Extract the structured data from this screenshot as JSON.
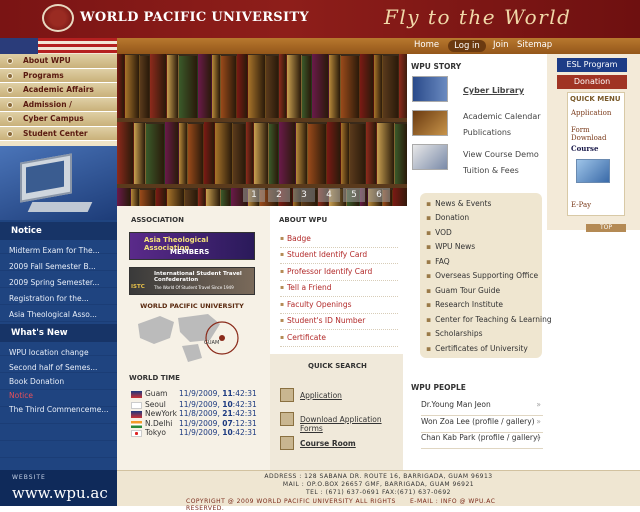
{
  "header": {
    "title": "WORLD PACIFIC UNIVERSITY",
    "slogan": "Fly to the World"
  },
  "topnav": {
    "home": "Home",
    "login": "Log in",
    "join": "Join",
    "sitemap": "Sitemap"
  },
  "leftnav": [
    "About WPU",
    "Programs",
    "Academic Affairs",
    "Admission / Graduation",
    "Cyber Campus",
    "Student Center"
  ],
  "notice": {
    "title": "Notice",
    "items": [
      "Midterm Exam for The...",
      "2009 Fall Semester B...",
      "2009 Spring Semester...",
      "Registration for the...",
      "Asia Theological Asso..."
    ]
  },
  "whatsnew": {
    "title": "What's New",
    "items": [
      "WPU location change",
      "Second half of Semes...",
      "Book Donation",
      "Notice",
      "The Third Commenceme..."
    ]
  },
  "website": {
    "label": "WEBSITE",
    "url": "www.wpu.ac"
  },
  "hero": {
    "pages": [
      "1",
      "2",
      "3",
      "4",
      "5",
      "6"
    ]
  },
  "story": {
    "title": "WPU STORY",
    "items": [
      "Cyber Library",
      "Academic Calendar",
      "Publications",
      "View Course Demo",
      "Tuition & Fees"
    ]
  },
  "right": {
    "esl": "ESL Program",
    "donation": "Donation",
    "quick_menu": "QUICK MENU",
    "menu": [
      "Application",
      "Form Download",
      "Course",
      "E-Pay"
    ],
    "top": "TOP"
  },
  "association": {
    "title": "ASSOCIATION",
    "banner1": "Asia Theological Association",
    "banner1b": "MEMBERS",
    "banner2": "International Student Travel Confederation",
    "banner2b": "The World Of Student Travel Since 1949",
    "banner2c": "ISTC",
    "map_title": "WORLD PACIFIC UNIVERSITY",
    "map_label": "GUAM"
  },
  "world_time": {
    "title": "WORLD TIME",
    "rows": [
      {
        "city": "Guam",
        "date": "11/9/2009,",
        "hm": "11",
        "sec": ":42:31"
      },
      {
        "city": "Seoul",
        "date": "11/9/2009,",
        "hm": "10",
        "sec": ":42:31"
      },
      {
        "city": "NewYork",
        "date": "11/8/2009,",
        "hm": "21",
        "sec": ":42:31"
      },
      {
        "city": "N.Delhi",
        "date": "11/9/2009,",
        "hm": "07",
        "sec": ":12:31"
      },
      {
        "city": "Tokyo",
        "date": "11/9/2009,",
        "hm": "10",
        "sec": ":42:31"
      }
    ]
  },
  "about": {
    "title": "ABOUT WPU",
    "items": [
      "Badge",
      "Student Identify Card",
      "Professor Identify Card",
      "Tell a Friend",
      "Faculty Openings",
      "Student's ID Number",
      "Certificate"
    ]
  },
  "quick_search": {
    "title": "QUICK SEARCH",
    "items": [
      "Application",
      "Download Application Forms",
      "Course Room"
    ]
  },
  "news": [
    "News & Events",
    "Donation",
    "VOD",
    "WPU News",
    "FAQ",
    "Overseas Supporting Office",
    "Guam Tour Guide",
    "Research Institute",
    "Center for Teaching & Learning",
    "Scholarships",
    "Certificates of University"
  ],
  "people": {
    "title": "WPU PEOPLE",
    "items": [
      "Dr.Young Man Jeon",
      "Won Zoa Lee (profile / gallery)",
      "Chan Kab Park (profile / gallery)"
    ]
  },
  "footer": {
    "address": "ADDRESS : 128 SABANA DR. ROUTE 16, BARRIGADA, GUAM 96913",
    "mail": "MAIL : OP.O.BOX 26657 GMF, BARRIGADA, GUAM 96921",
    "tel": "TEL : (671) 637-0691   FAX:(671) 637-0692",
    "copy": "COPYRIGHT @ 2009  WORLD PACIFIC UNIVERSITY  ALL RIGHTS RESERVED.",
    "email": "E-MAIL : INFO @ WPU.AC"
  },
  "colors": {
    "header": "#8e1e1a",
    "nav": "#b8782e",
    "left_blue": "#1f4480"
  }
}
